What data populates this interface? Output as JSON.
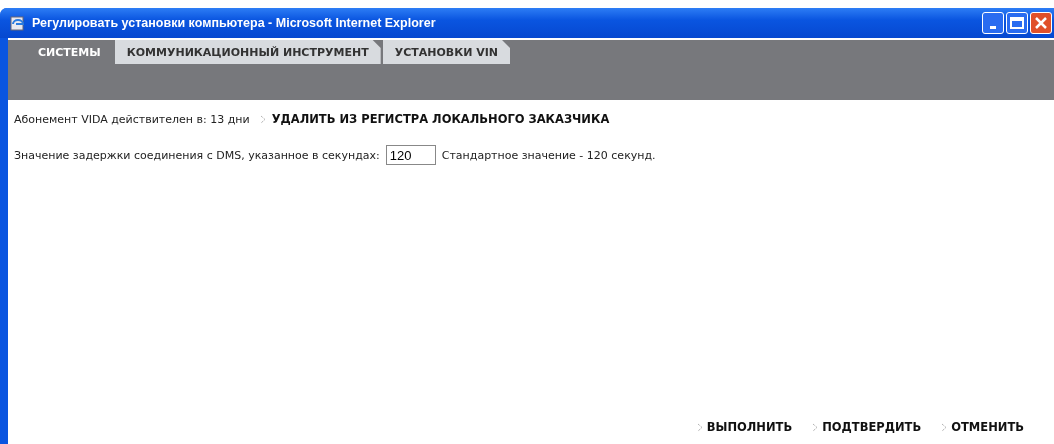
{
  "window": {
    "title": "Регулировать установки компьютера - Microsoft Internet Explorer"
  },
  "tabs": [
    {
      "label": "СИСТЕМЫ",
      "selected": true
    },
    {
      "label": "КОММУНИКАЦИОННЫЙ ИНСТРУМЕНТ",
      "selected": false
    },
    {
      "label": "УСТАНОВКИ VIN",
      "selected": false
    }
  ],
  "subscription": {
    "text": "Абонемент VIDA действителен в: 13 дни",
    "link": "УДАЛИТЬ ИЗ РЕГИСТРА ЛОКАЛЬНОГО ЗАКАЗЧИКА"
  },
  "timeout": {
    "label": "Значение задержки соединения с DMS, указанное в секундах:",
    "value": "120",
    "note": "Стандартное значение - 120 секунд."
  },
  "buttons": [
    "ВЫПОЛНИТЬ",
    "ПОДТВЕРДИТЬ",
    "ОТМЕНИТЬ"
  ]
}
